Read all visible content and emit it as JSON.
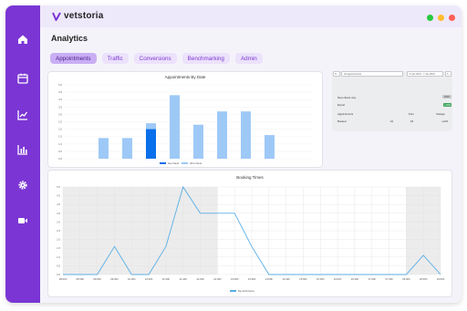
{
  "app": {
    "name": "vetstoria"
  },
  "page": {
    "title": "Analytics"
  },
  "sidebar": {
    "icons": [
      "home-icon",
      "calendar-icon",
      "trend-chart-icon",
      "bar-chart-icon",
      "gear-icon",
      "video-icon"
    ]
  },
  "window_controls": {
    "colors": [
      "#27c93f",
      "#ffbd2e",
      "#ff5f56"
    ]
  },
  "tabs": [
    {
      "label": "Appointments",
      "active": true
    },
    {
      "label": "Traffic",
      "active": false
    },
    {
      "label": "Conversions",
      "active": false
    },
    {
      "label": "Benchmarking",
      "active": false
    },
    {
      "label": "Admin",
      "active": false
    }
  ],
  "filters": {
    "appointments_select": "All appointments",
    "date_range": "5 Jan 2021 - 7 Jan 2021"
  },
  "summary": {
    "new_clients_label": "New clients only",
    "export_label": "Export",
    "export_button": "CSV",
    "badge": "+10%",
    "headers": [
      "Appointments",
      "Prev",
      "Change"
    ],
    "rows": [
      [
        "Booked",
        "16",
        "18",
        "+12%"
      ]
    ]
  },
  "colors": {
    "accent": "#7b35d4",
    "bar_light": "#9ec9f7",
    "bar_dark": "#0a6fea",
    "line": "#5aaee6"
  },
  "chart_data": [
    {
      "type": "bar",
      "title": "Appointments By Date",
      "categories": [
        "",
        "",
        "",
        "",
        "",
        "",
        "",
        ""
      ],
      "ylim": [
        0,
        5
      ],
      "y_ticks": [
        "0.0",
        "0.5",
        "1.0",
        "1.5",
        "2.0",
        "2.5",
        "3.0",
        "3.5",
        "4.0",
        "4.5",
        "5.0"
      ],
      "series": [
        {
          "name": "New Clients",
          "values": [
            0,
            0,
            2,
            0,
            0,
            0,
            0,
            0
          ]
        },
        {
          "name": "Clinic Clients",
          "values": [
            1.4,
            1.4,
            2.4,
            4.3,
            2.3,
            3.2,
            3.2,
            1.6
          ]
        }
      ]
    },
    {
      "type": "line",
      "title": "Booking Times",
      "x": [
        "08:00h",
        "08:30h",
        "09:00h",
        "09:30h",
        "10:00h",
        "10:30h",
        "11:00h",
        "11:30h",
        "12:00h",
        "12:30h",
        "13:00h",
        "13:30h",
        "14:00h",
        "14:30h",
        "15:00h",
        "15:30h",
        "16:00h",
        "16:30h",
        "17:00h",
        "17:30h",
        "18:00h",
        "18:30h",
        "19:00h"
      ],
      "ylim": [
        0,
        5
      ],
      "y_ticks": [
        "0.0",
        "0.5",
        "1.0",
        "1.5",
        "2.0",
        "2.5",
        "3.0",
        "3.5",
        "4.0",
        "4.5",
        "5.0"
      ],
      "series": [
        {
          "name": "Day Performance",
          "values": [
            0,
            0,
            0,
            1.6,
            0,
            0,
            1.6,
            5,
            3.5,
            3.5,
            3.5,
            1.6,
            0,
            0,
            0,
            0,
            0,
            0,
            0,
            0,
            0,
            1.1,
            0
          ]
        }
      ],
      "grid": true
    }
  ]
}
